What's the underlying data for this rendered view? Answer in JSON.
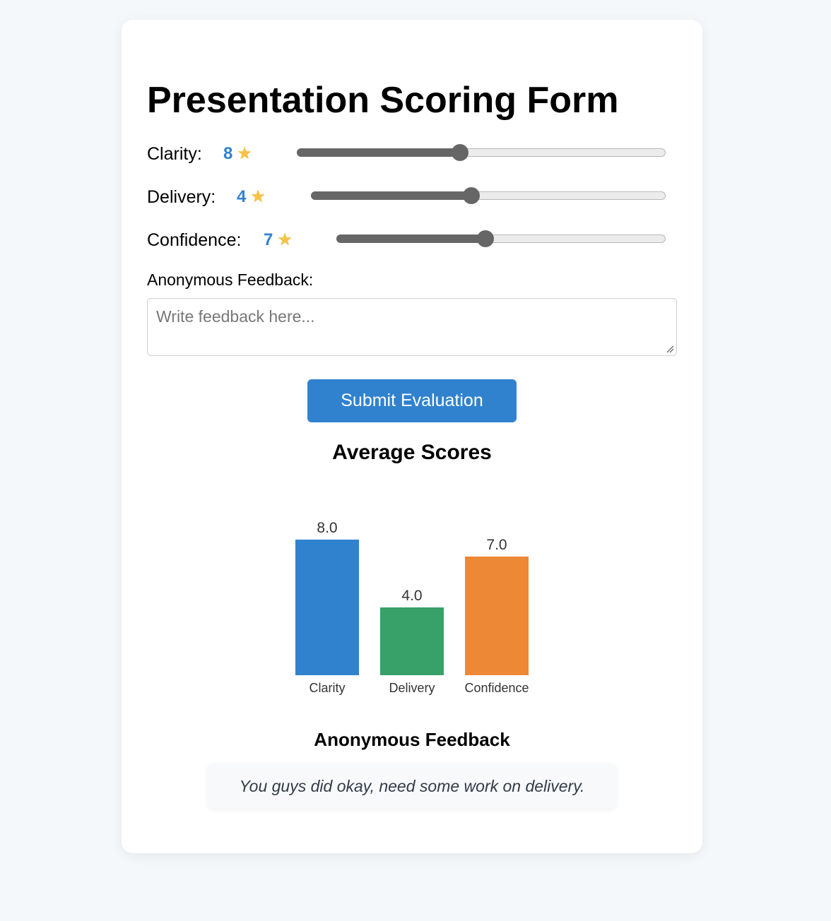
{
  "form": {
    "title": "Presentation Scoring Form",
    "scores": [
      {
        "label": "Clarity:",
        "value": "8",
        "slider_fraction": 0.44
      },
      {
        "label": "Delivery:",
        "value": "4",
        "slider_fraction": 0.45
      },
      {
        "label": "Confidence:",
        "value": "7",
        "slider_fraction": 0.45
      }
    ],
    "star_icon": "star-icon",
    "feedback_label": "Anonymous Feedback:",
    "feedback_placeholder": "Write feedback here...",
    "submit_label": "Submit Evaluation",
    "accent_color": "#3182ce"
  },
  "results": {
    "average_heading": "Average Scores",
    "feedback_heading": "Anonymous Feedback",
    "feedback_entries": [
      "You guys did okay, need some work on delivery."
    ]
  },
  "chart_data": {
    "type": "bar",
    "title": "Average Scores",
    "categories": [
      "Clarity",
      "Delivery",
      "Confidence"
    ],
    "values": [
      8.0,
      4.0,
      7.0
    ],
    "data_labels": [
      "8.0",
      "4.0",
      "7.0"
    ],
    "colors": [
      "#3182ce",
      "#38a169",
      "#ed8936"
    ],
    "ylim": [
      0,
      10
    ],
    "grid": false,
    "legend": "none"
  }
}
